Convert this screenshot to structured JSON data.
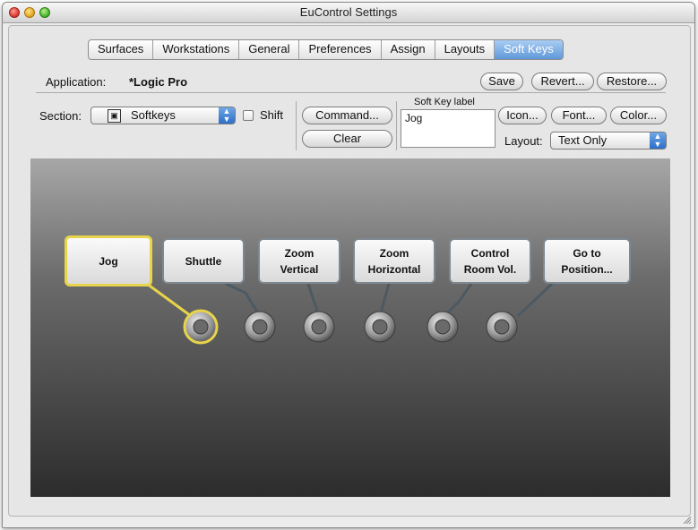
{
  "window": {
    "title": "EuControl Settings"
  },
  "tabs": [
    "Surfaces",
    "Workstations",
    "General",
    "Preferences",
    "Assign",
    "Layouts",
    "Soft Keys"
  ],
  "active_tab": "Soft Keys",
  "application": {
    "label": "Application:",
    "value": "*Logic Pro"
  },
  "buttons": {
    "save": "Save",
    "revert": "Revert...",
    "restore": "Restore...",
    "command": "Command...",
    "clear": "Clear",
    "icon": "Icon...",
    "font": "Font...",
    "color": "Color..."
  },
  "section": {
    "label": "Section:",
    "value": "Softkeys",
    "icon": "softkeys-icon"
  },
  "shift": {
    "label": "Shift",
    "checked": false
  },
  "soft_key_label": {
    "caption": "Soft Key label",
    "value": "Jog"
  },
  "layout": {
    "label": "Layout:",
    "value": "Text Only"
  },
  "softkeys": [
    {
      "label": "Jog",
      "selected": true
    },
    {
      "label": "Shuttle",
      "selected": false
    },
    {
      "label": "Zoom\nVertical",
      "selected": false
    },
    {
      "label": "Zoom\nHorizontal",
      "selected": false
    },
    {
      "label": "Control\nRoom Vol.",
      "selected": false
    },
    {
      "label": "Go to Position...",
      "selected": false
    }
  ],
  "colors": {
    "accent": "#5f98d9",
    "selected_outline": "#e7d44a"
  }
}
